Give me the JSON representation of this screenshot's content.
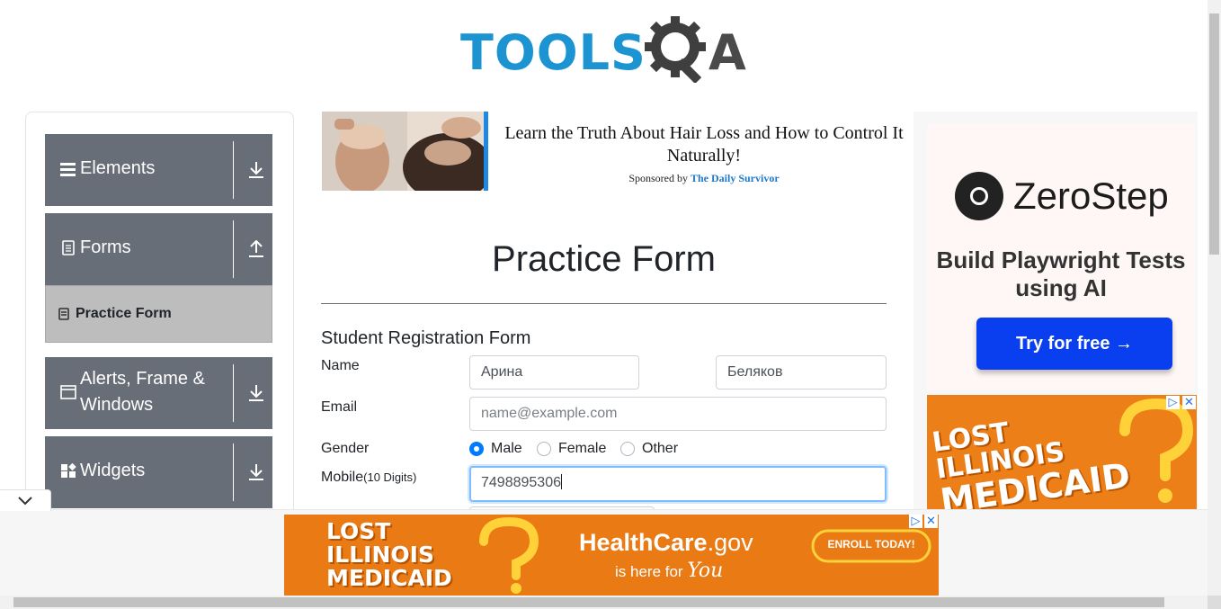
{
  "logo": {
    "part1": "TOOLS",
    "part2": "A",
    "colors": {
      "tools": "#1c94d2",
      "qa": "#4a4a4a"
    }
  },
  "sidebar": {
    "groups": [
      {
        "label": "Elements",
        "icon": "hamburger-icon",
        "arrow": "download-icon"
      },
      {
        "label": "Forms",
        "icon": "document-icon",
        "arrow": "upload-icon"
      },
      {
        "label": "Alerts, Frame & Windows",
        "icon": "window-icon",
        "arrow": "download-icon"
      },
      {
        "label": "Widgets",
        "icon": "widgets-icon",
        "arrow": "download-icon"
      }
    ],
    "active_item": {
      "label": "Practice Form",
      "icon": "form-icon"
    }
  },
  "ad_top": {
    "headline": "Learn the Truth About Hair Loss and How to Control It Naturally!",
    "sponsor_prefix": "Sponsored by",
    "sponsor_name": "The Daily Survivor"
  },
  "main": {
    "title": "Practice Form",
    "form_title": "Student Registration Form",
    "labels": {
      "name": "Name",
      "email": "Email",
      "gender": "Gender",
      "mobile": "Mobile",
      "mobile_hint": "(10 Digits)"
    },
    "first_name": "Арина",
    "last_name": "Беляков",
    "email_placeholder": "name@example.com",
    "gender_options": [
      "Male",
      "Female",
      "Other"
    ],
    "gender_selected": "Male",
    "mobile_value": "7498895306"
  },
  "ad_right": {
    "brand": "ZeroStep",
    "tagline": "Build Playwright Tests using AI",
    "cta": "Try for free →"
  },
  "ad_medicaid": {
    "line1": "LOST",
    "line2": "ILLINOIS",
    "line3": "MEDICAID",
    "site_a": "HealthCare",
    "site_b": ".gov",
    "sub_a": "is here for ",
    "sub_b": "You",
    "cta": "ENROLL TODAY!"
  }
}
